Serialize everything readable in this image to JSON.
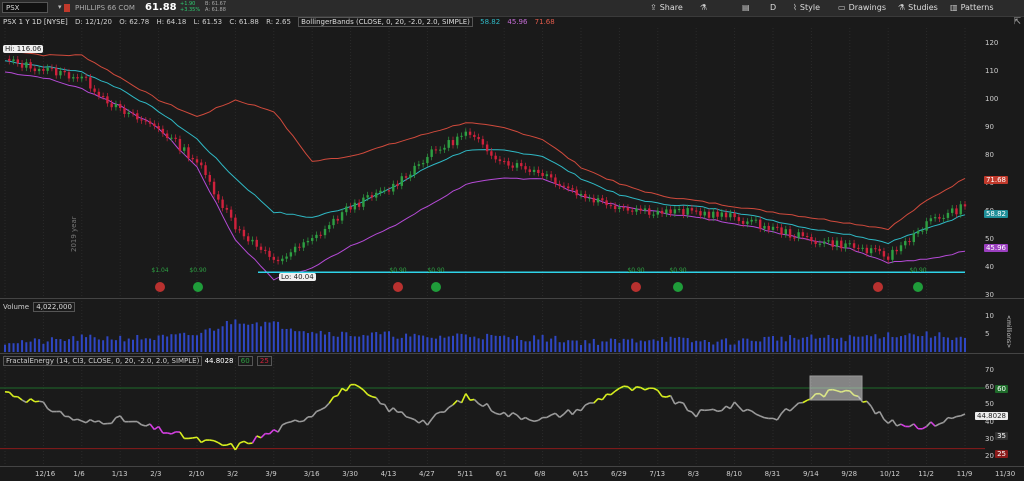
{
  "toolbar": {
    "symbol": "PSX",
    "company": "PHILLIPS 66 COM",
    "price": "61.88",
    "change": "+1.90",
    "change_pct": "+3.35%",
    "bid": "B: 61.67",
    "ask": "A: 61.88",
    "share": "Share",
    "timeframe": "D",
    "style": "Style",
    "drawings": "Drawings",
    "studies": "Studies",
    "patterns": "Patterns"
  },
  "infobar": {
    "title": "PSX 1 Y 1D [NYSE]",
    "date": "D: 12/1/20",
    "open": "O: 62.78",
    "high": "H: 64.18",
    "low": "L: 61.53",
    "close": "C: 61.88",
    "range": "R: 2.65",
    "study": "BollingerBands (CLOSE, 0, 20, -2.0, 2.0, SIMPLE)",
    "bb_mid": "58.82",
    "bb_low": "45.96",
    "bb_up": "71.68"
  },
  "price_pane": {
    "hi_label": "Hi: 116.06",
    "lo_label": "Lo: 40.04",
    "year_label": "2019 year",
    "y_ticks": [
      "120",
      "110",
      "100",
      "90",
      "80",
      "70",
      "60",
      "50",
      "40",
      "30"
    ],
    "tags": {
      "upper": "71.68",
      "mid": "58.82",
      "lower": "45.96"
    },
    "dividends": [
      "$1.04",
      "$0.90",
      "$0.90",
      "$0.90",
      "$0.90",
      "$0.90",
      "$0.90"
    ],
    "hline": 38.5
  },
  "volume_pane": {
    "label": "Volume",
    "value": "4,022,000",
    "y_ticks": [
      "10",
      "5"
    ],
    "unit": "<millions>"
  },
  "fe_pane": {
    "label": "FractalEnergy (14, CI3, CLOSE, 0, 20, -2.0, 2.0, SIMPLE)",
    "value": "44.8028",
    "box1": "60",
    "box2": "25",
    "y_ticks": [
      "70",
      "60",
      "50",
      "40",
      "30",
      "20"
    ],
    "tags": {
      "t60": "60",
      "val": "44.8028",
      "t35": "35",
      "t25": "25"
    }
  },
  "x_dates": [
    "12/16",
    "1/6",
    "1/13",
    "2/3",
    "2/10",
    "3/2",
    "3/9",
    "3/16",
    "3/30",
    "4/13",
    "4/27",
    "5/11",
    "6/1",
    "6/8",
    "6/15",
    "6/29",
    "7/13",
    "8/3",
    "8/10",
    "8/31",
    "9/14",
    "9/28",
    "10/12",
    "11/2",
    "11/9",
    "11/30"
  ],
  "colors": {
    "bg": "#1a1a1a",
    "upper_band": "#d04a3c",
    "mid_band": "#2fb9c5",
    "lower_band": "#b54ad6",
    "up_candle": "#2ea043",
    "down_candle": "#d0213c",
    "support": "#2fd3e8",
    "volume": "#2f47c4",
    "fe_line": "#9a9a9a",
    "fe_high": "#d8ef1f",
    "fe_low": "#d23fe0"
  },
  "chart_data": {
    "type": "line",
    "title": "PSX 1 Y 1D [NYSE]",
    "xlabel": "",
    "ylabel": "",
    "ylim": [
      30,
      125
    ],
    "x": [
      "12/16",
      "1/6",
      "1/13",
      "2/3",
      "2/10",
      "3/2",
      "3/9",
      "3/16",
      "3/30",
      "4/13",
      "4/27",
      "5/11",
      "6/1",
      "6/8",
      "6/15",
      "6/29",
      "7/13",
      "8/3",
      "8/10",
      "8/31",
      "9/14",
      "9/28",
      "10/12",
      "11/2",
      "11/9",
      "11/30"
    ],
    "series": [
      {
        "name": "Close",
        "values": [
          114,
          111,
          108,
          96,
          90,
          78,
          55,
          42,
          50,
          62,
          68,
          80,
          88,
          78,
          74,
          66,
          62,
          60,
          60,
          58,
          54,
          50,
          48,
          44,
          56,
          62
        ]
      },
      {
        "name": "Upper",
        "values": [
          118,
          116,
          116,
          108,
          100,
          94,
          100,
          96,
          78,
          80,
          84,
          88,
          92,
          90,
          86,
          76,
          70,
          66,
          64,
          62,
          60,
          58,
          56,
          54,
          64,
          72
        ]
      },
      {
        "name": "Middle",
        "values": [
          114,
          112,
          110,
          104,
          96,
          86,
          72,
          60,
          58,
          62,
          68,
          76,
          82,
          82,
          80,
          72,
          66,
          63,
          62,
          60,
          57,
          54,
          52,
          49,
          54,
          59
        ]
      },
      {
        "name": "Lower",
        "values": [
          110,
          108,
          104,
          98,
          90,
          76,
          50,
          36,
          40,
          48,
          54,
          62,
          70,
          72,
          72,
          66,
          62,
          60,
          58,
          56,
          53,
          50,
          47,
          42,
          43,
          46
        ]
      }
    ],
    "volume_millions": [
      3,
      3,
      4,
      4,
      4,
      5,
      9,
      8,
      6,
      5,
      5,
      4,
      5,
      4,
      4,
      3,
      3,
      4,
      3,
      3,
      4,
      4,
      4,
      5,
      5,
      4
    ],
    "fractal_energy": [
      58,
      50,
      40,
      42,
      36,
      30,
      26,
      35,
      45,
      62,
      48,
      40,
      55,
      45,
      42,
      48,
      60,
      58,
      45,
      50,
      42,
      55,
      60,
      40,
      38,
      45
    ],
    "legend": "none"
  }
}
